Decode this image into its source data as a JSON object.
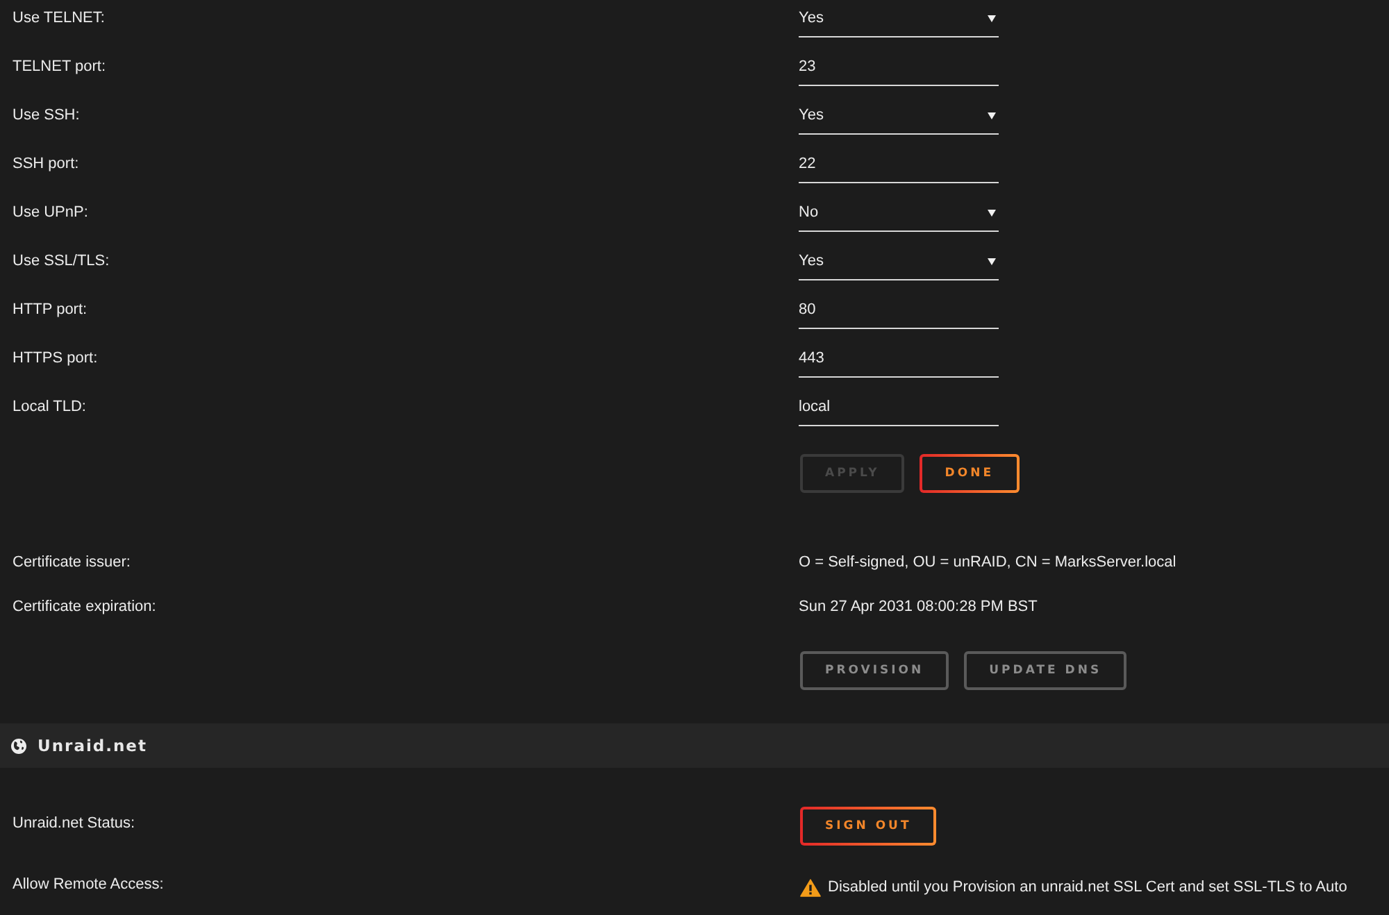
{
  "settings": [
    {
      "label": "Use TELNET:",
      "kind": "select",
      "value": "Yes"
    },
    {
      "label": "TELNET port:",
      "kind": "text",
      "value": "23"
    },
    {
      "label": "Use SSH:",
      "kind": "select",
      "value": "Yes"
    },
    {
      "label": "SSH port:",
      "kind": "text",
      "value": "22"
    },
    {
      "label": "Use UPnP:",
      "kind": "select",
      "value": "No"
    },
    {
      "label": "Use SSL/TLS:",
      "kind": "select",
      "value": "Yes"
    },
    {
      "label": "HTTP port:",
      "kind": "text",
      "value": "80"
    },
    {
      "label": "HTTPS port:",
      "kind": "text",
      "value": "443"
    },
    {
      "label": "Local TLD:",
      "kind": "text",
      "value": "local"
    }
  ],
  "actions": [
    {
      "label": "APPLY",
      "kind": "plain",
      "disabled": true
    },
    {
      "label": "DONE",
      "kind": "accent",
      "disabled": false
    }
  ],
  "certificate": {
    "rows": [
      {
        "label": "Certificate issuer:",
        "value": "O = Self-signed, OU = unRAID, CN = MarksServer.local"
      },
      {
        "label": "Certificate expiration:",
        "value": "Sun 27 Apr 2031 08:00:28 PM BST"
      }
    ],
    "actions": [
      {
        "label": "PROVISION",
        "kind": "plain",
        "disabled": false
      },
      {
        "label": "UPDATE DNS",
        "kind": "plain",
        "disabled": false
      }
    ]
  },
  "unraid_net": {
    "title": "Unraid.net",
    "rows": [
      {
        "label": "Unraid.net Status:",
        "kind": "button",
        "button": {
          "label": "SIGN OUT",
          "kind": "accent",
          "disabled": false
        }
      },
      {
        "label": "Allow Remote Access:",
        "kind": "warning",
        "text": "Disabled until you Provision an unraid.net SSL Cert and set SSL-TLS to Auto"
      }
    ]
  }
}
